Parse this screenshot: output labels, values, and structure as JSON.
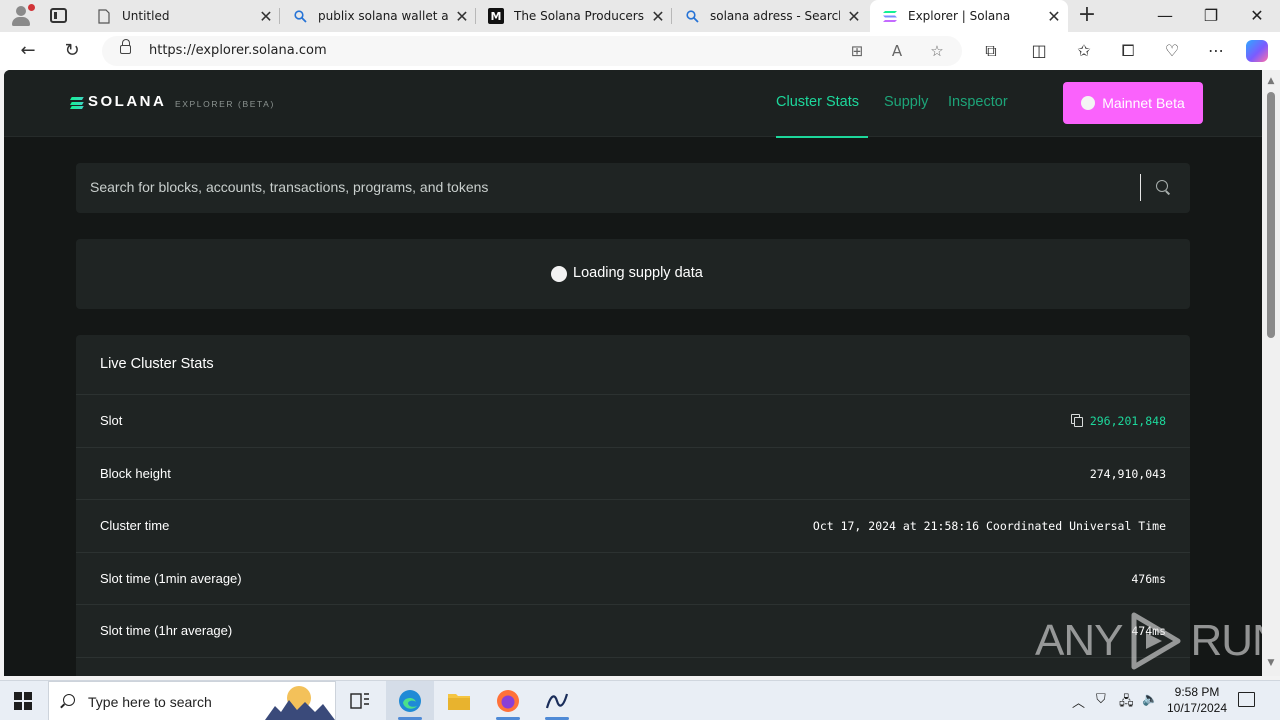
{
  "browser": {
    "tabs": [
      {
        "title": "Untitled",
        "icon": "document-icon"
      },
      {
        "title": "publix solana wallet adre",
        "icon": "search-icon"
      },
      {
        "title": "The Solana Producers List",
        "icon": "medium-icon"
      },
      {
        "title": "solana adress - Search",
        "icon": "search-icon"
      },
      {
        "title": "Explorer | Solana",
        "icon": "solana-icon",
        "active": true
      }
    ],
    "url": "https://explorer.solana.com",
    "favicon_text": "M"
  },
  "site": {
    "brand": "SOLANA",
    "brand_sub": "EXPLORER (BETA)",
    "nav": [
      "Cluster Stats",
      "Supply",
      "Inspector"
    ],
    "active_nav": "Cluster Stats",
    "cluster_button": "Mainnet Beta",
    "accent_color": "#1dd79b",
    "cluster_color": "#fa62fc"
  },
  "search": {
    "placeholder": "Search for blocks, accounts, transactions, programs, and tokens"
  },
  "supply": {
    "loading_text": "Loading supply data"
  },
  "stats": {
    "title": "Live Cluster Stats",
    "rows": [
      {
        "label": "Slot",
        "value": "296,201,848"
      },
      {
        "label": "Block height",
        "value": "274,910,043"
      },
      {
        "label": "Cluster time",
        "value": "Oct 17, 2024 at 21:58:16 Coordinated Universal Time"
      },
      {
        "label": "Slot time (1min average)",
        "value": "476ms"
      },
      {
        "label": "Slot time (1hr average)",
        "value": "474ms"
      }
    ]
  },
  "watermark": {
    "left": "ANY",
    "right": "RUN"
  },
  "taskbar": {
    "search_placeholder": "Type here to search",
    "time": "9:58 PM",
    "date": "10/17/2024"
  }
}
